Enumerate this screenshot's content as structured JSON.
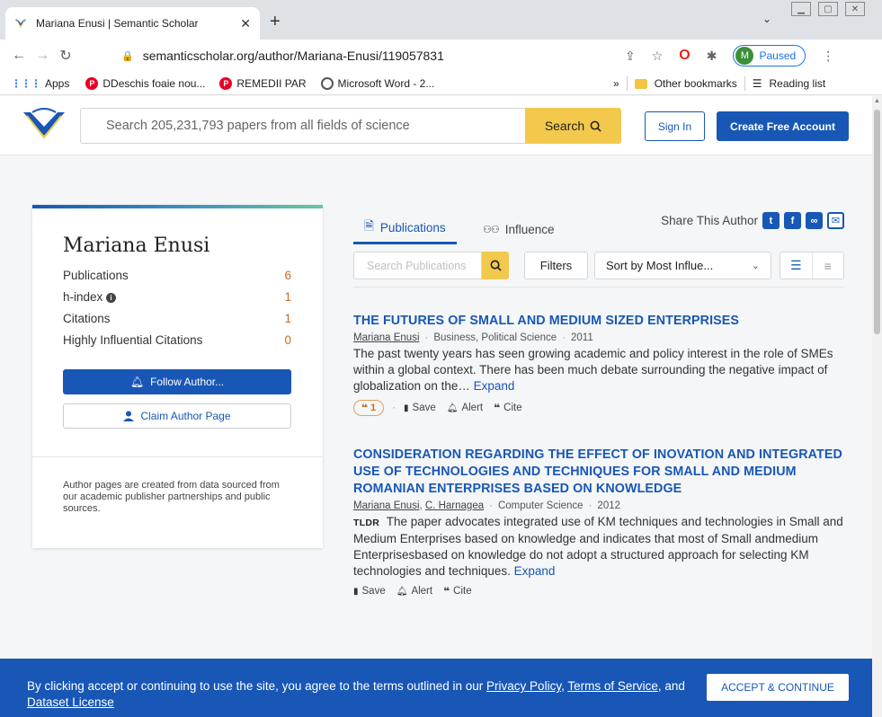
{
  "browser": {
    "tab_title": "Mariana Enusi | Semantic Scholar",
    "tab_close": "✕",
    "new_tab": "+",
    "url": "semanticscholar.org/author/Mariana-Enusi/119057831",
    "profile_initial": "M",
    "profile_status": "Paused",
    "bookmarks": [
      {
        "label": "Apps"
      },
      {
        "label": "DDeschis foaie nou..."
      },
      {
        "label": "REMEDII PAR"
      },
      {
        "label": "Microsoft Word - 2..."
      }
    ],
    "bookmarks_overflow": "»",
    "other_bookmarks": "Other bookmarks",
    "reading_list": "Reading list"
  },
  "header": {
    "search_placeholder": "Search 205,231,793 papers from all fields of science",
    "search_button": "Search",
    "sign_in": "Sign In",
    "create_account": "Create Free Account"
  },
  "author": {
    "name": "Mariana Enusi",
    "stats": [
      {
        "label": "Publications",
        "value": "6"
      },
      {
        "label": "h-index",
        "value": "1"
      },
      {
        "label": "Citations",
        "value": "1"
      },
      {
        "label": "Highly Influential Citations",
        "value": "0"
      }
    ],
    "follow_button": "Follow Author...",
    "claim_button": "Claim Author Page",
    "note": "Author pages are created from data sourced from our academic publisher partnerships and public sources."
  },
  "tabs": {
    "publications": "Publications",
    "influence": "Influence",
    "share_label": "Share This Author"
  },
  "toolbar": {
    "search_placeholder": "Search Publications",
    "filters": "Filters",
    "sort": "Sort by Most Influe..."
  },
  "papers": [
    {
      "title": "THE FUTURES OF SMALL AND MEDIUM SIZED ENTERPRISES",
      "authors": "Mariana Enusi",
      "fields": "Business, Political Science",
      "year": "2011",
      "abstract": "The past twenty years has seen growing academic and policy interest in the role of SMEs within a global context. There has been much debate surrounding the negative impact of globalization on the…",
      "expand": "Expand",
      "citations": "1",
      "save": "Save",
      "alert": "Alert",
      "cite": "Cite"
    },
    {
      "title": "CONSIDERATION REGARDING THE EFFECT OF INOVATION AND INTEGRATED USE OF TECHNOLOGIES AND TECHNIQUES FOR SMALL AND MEDIUM ROMANIAN ENTERPRISES BASED ON KNOWLEDGE",
      "authors": "Mariana Enusi",
      "coauthor": "C. Harnagea",
      "fields": "Computer Science",
      "year": "2012",
      "tldr": "TLDR",
      "abstract": "The paper advocates integrated use of KM techniques and technologies in Small and Medium Enterprises based on knowledge and indicates that most of Small andmedium Enterprisesbased on knowledge do not adopt a structured approach for selecting KM technologies and techniques.",
      "expand": "Expand",
      "save": "Save",
      "alert": "Alert",
      "cite": "Cite"
    }
  ],
  "cookie": {
    "text_before": "By clicking accept or continuing to use the site, you agree to the terms outlined in our ",
    "privacy": "Privacy Policy",
    "comma": ", ",
    "terms": "Terms of Service",
    "and": ", and ",
    "dataset": "Dataset License",
    "accept": "ACCEPT & CONTINUE"
  },
  "colors": {
    "brand_blue": "#1857b6",
    "accent_yellow": "#f2c94c",
    "stat_orange": "#c86a1e"
  }
}
